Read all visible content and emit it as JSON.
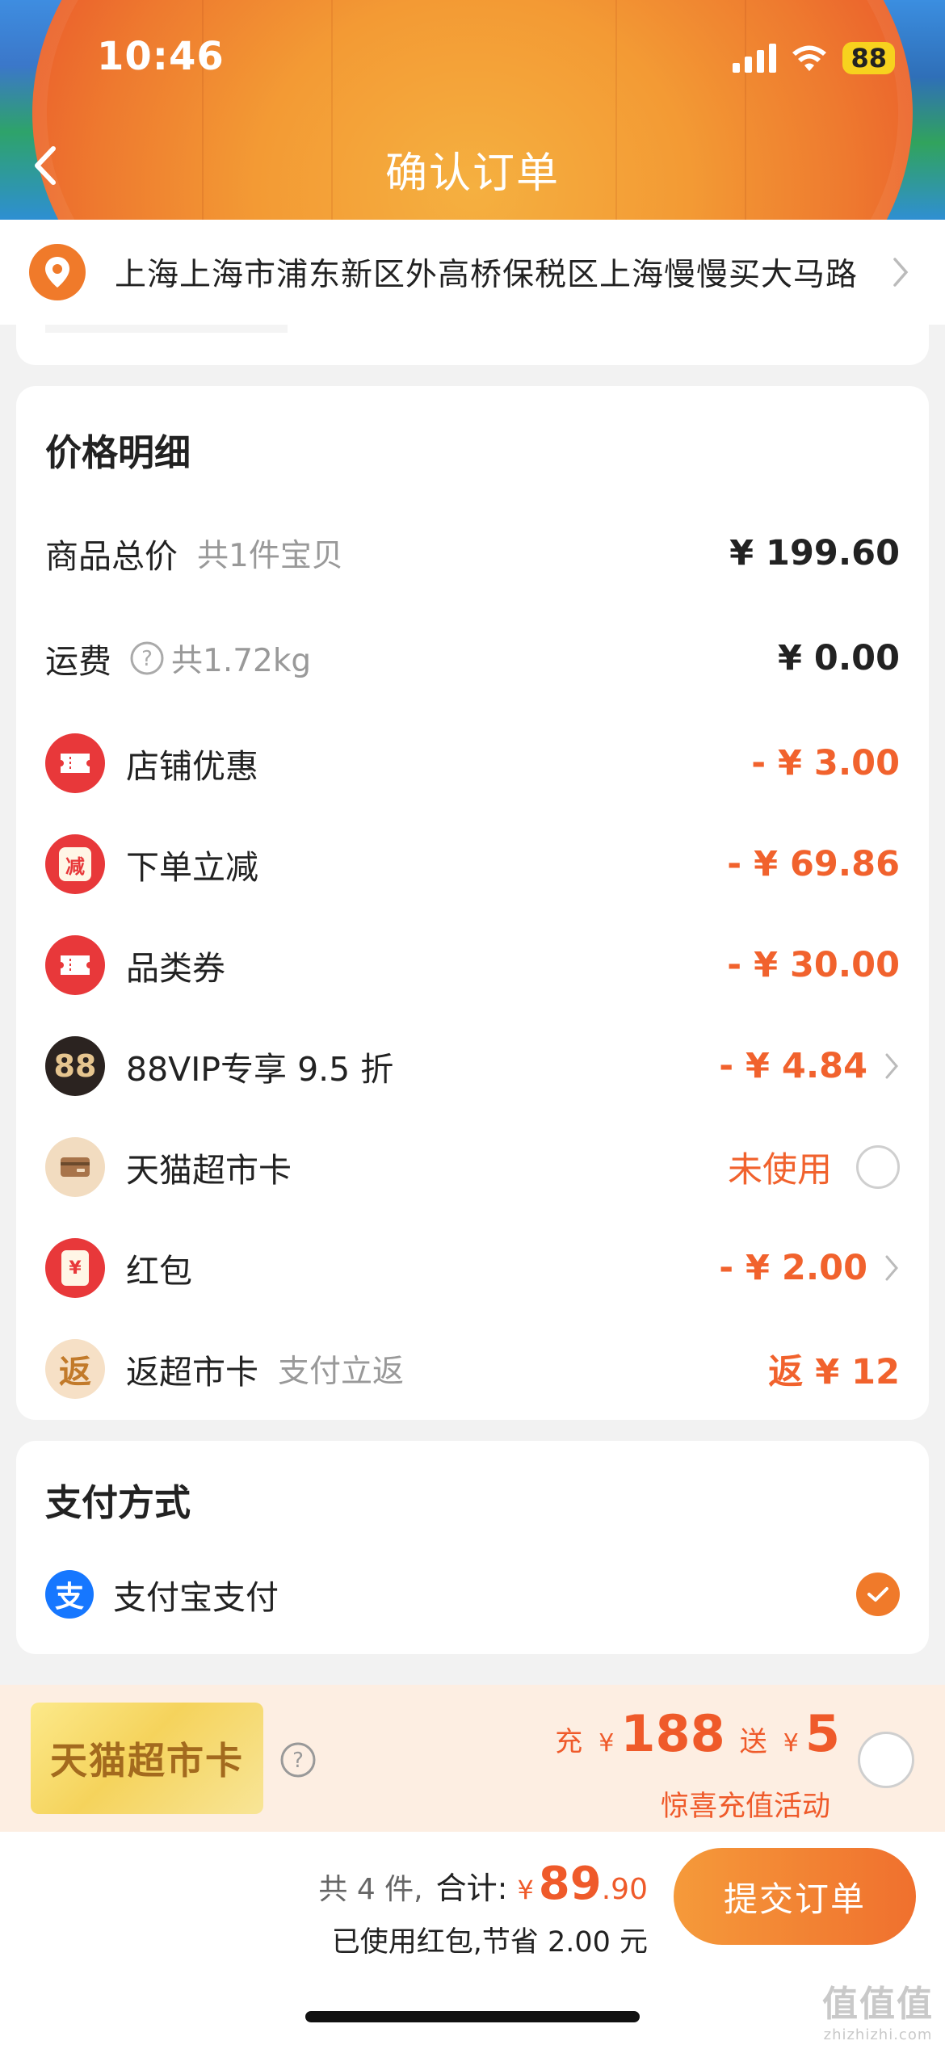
{
  "status_bar": {
    "time": "10:46",
    "battery": "88"
  },
  "nav": {
    "title": "确认订单",
    "back_icon": "chevron-left-icon"
  },
  "address": {
    "text": "上海上海市浦东新区外高桥保税区上海慢慢买大马路",
    "icon": "location-pin-icon"
  },
  "price_detail": {
    "title": "价格明细",
    "items": [
      {
        "label": "商品总价",
        "sub": "共1件宝贝",
        "value": "¥ 199.60"
      },
      {
        "label": "运费",
        "sub": "共1.72kg",
        "value": "¥ 0.00",
        "icon": "question-circle-icon"
      },
      {
        "label": "店铺优惠",
        "value": "- ¥ 3.00",
        "icon": "coupon-icon"
      },
      {
        "label": "下单立减",
        "value": "- ¥ 69.86",
        "icon": "jian-icon",
        "icon_text": "减"
      },
      {
        "label": "品类券",
        "value": "- ¥ 30.00",
        "icon": "coupon-icon"
      },
      {
        "label": "88VIP专享 9.5 折",
        "value": "- ¥ 4.84",
        "icon": "88vip-icon",
        "icon_text": "88"
      },
      {
        "label": "天猫超市卡",
        "value": "未使用",
        "icon": "card-icon"
      },
      {
        "label": "红包",
        "value": "- ¥ 2.00",
        "icon": "red-packet-icon",
        "icon_text": "¥"
      },
      {
        "label": "返超市卡",
        "sub": "支付立返",
        "value": "返 ¥ 12",
        "icon": "fan-icon",
        "icon_text": "返"
      }
    ]
  },
  "payment": {
    "title": "支付方式",
    "method": "支付宝支付",
    "icon_text": "支",
    "selected": true
  },
  "promo": {
    "card_label": "天猫超市卡",
    "charge_label": "充",
    "charge_currency": "¥",
    "charge_amount": "188",
    "gift_label": "送",
    "gift_currency": "¥",
    "gift_amount": "5",
    "subtitle": "惊喜充值活动",
    "selected": false
  },
  "footer": {
    "count": "共 4 件,",
    "total_label": "合计:",
    "currency": "¥",
    "total_int": "89",
    "total_dec": ".90",
    "savings": "已使用红包,节省 2.00 元",
    "submit_label": "提交订单"
  },
  "watermark": {
    "logo": "值值值",
    "url": "zhizhizhi.com"
  },
  "colors": {
    "accent": "#f1622d",
    "header_orange": "#f08a2e",
    "alipay_blue": "#1677ff",
    "coupon_red": "#e8383a"
  }
}
